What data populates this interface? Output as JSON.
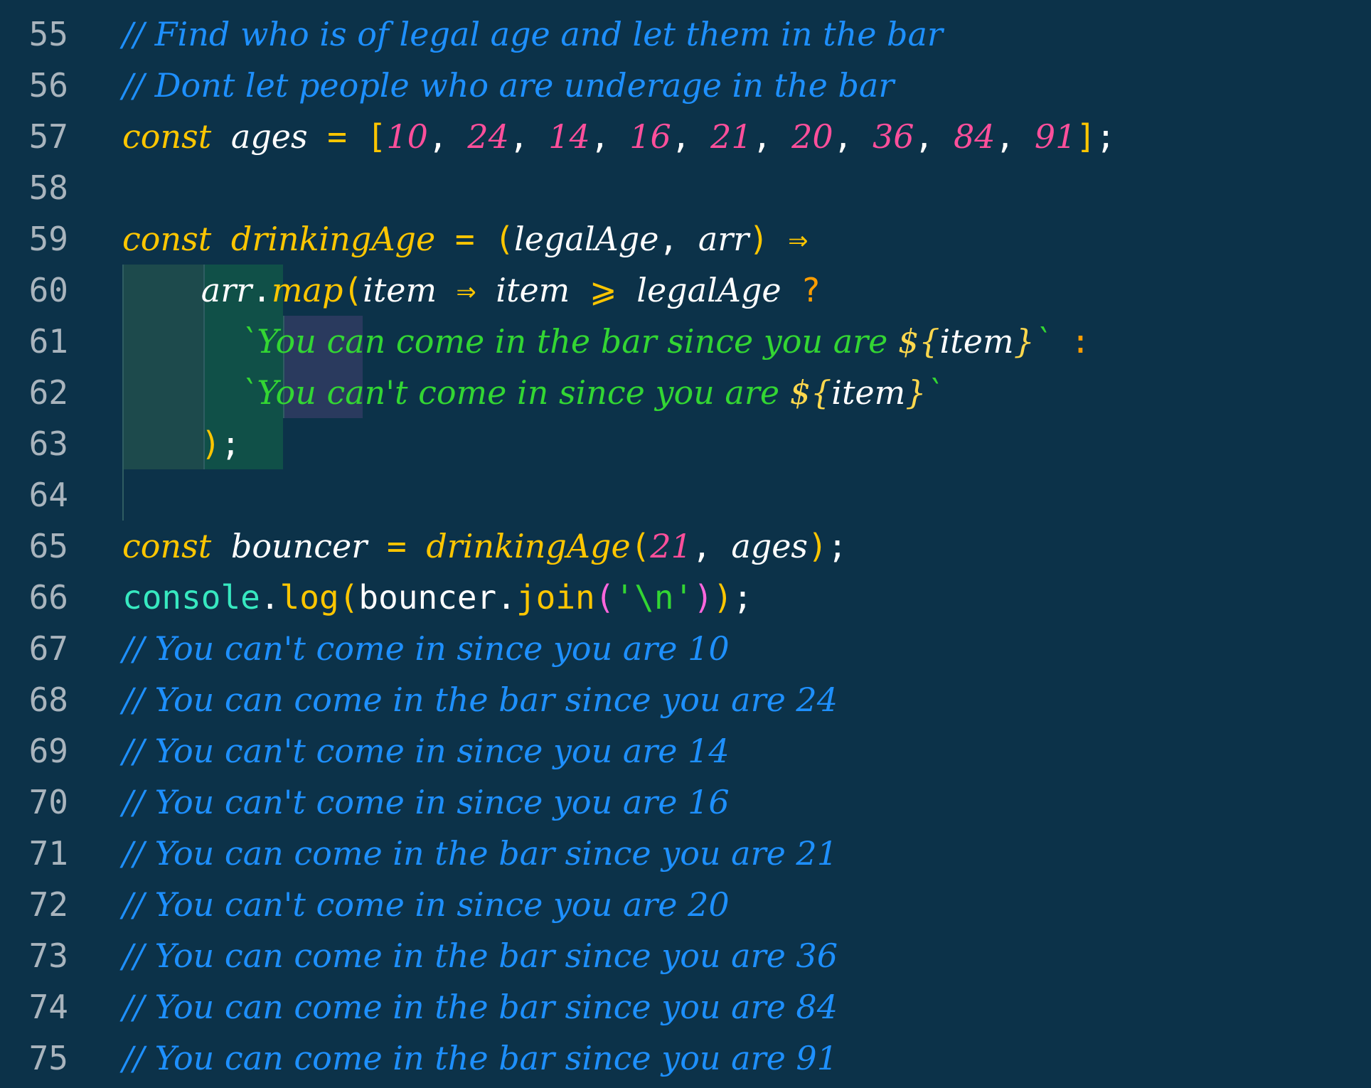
{
  "editor": {
    "colors": {
      "background": "#0c3249",
      "line_number": "#a9b4bd",
      "comment": "#1e90ff",
      "keyword": "#ffc600",
      "number": "#ff4f9b",
      "string": "#33d633",
      "identifier": "#ffffff",
      "operator": "#ffc600",
      "ternary": "#ff9d00",
      "console": "#37e8c0",
      "function": "#ffc600",
      "bracket_pink": "#ff66dd",
      "template_var": "#ffd84d"
    },
    "lines": [
      {
        "number": "55",
        "tokens": [
          {
            "text": "// Find who is of legal age and let them in the bar",
            "kind": "comment",
            "italic": true
          }
        ]
      },
      {
        "number": "56",
        "tokens": [
          {
            "text": "// Dont let people who are underage in the bar",
            "kind": "comment",
            "italic": true
          }
        ]
      },
      {
        "number": "57",
        "tokens": [
          {
            "text": "const",
            "kind": "keyword",
            "italic": true
          },
          {
            "text": " ",
            "kind": "identifier"
          },
          {
            "text": "ages",
            "kind": "identifier",
            "italic": true
          },
          {
            "text": " = ",
            "kind": "operator"
          },
          {
            "text": "[",
            "kind": "keyword"
          },
          {
            "text": "10",
            "kind": "number",
            "italic": true
          },
          {
            "text": ", ",
            "kind": "identifier"
          },
          {
            "text": "24",
            "kind": "number",
            "italic": true
          },
          {
            "text": ", ",
            "kind": "identifier"
          },
          {
            "text": "14",
            "kind": "number",
            "italic": true
          },
          {
            "text": ", ",
            "kind": "identifier"
          },
          {
            "text": "16",
            "kind": "number",
            "italic": true
          },
          {
            "text": ", ",
            "kind": "identifier"
          },
          {
            "text": "21",
            "kind": "number",
            "italic": true
          },
          {
            "text": ", ",
            "kind": "identifier"
          },
          {
            "text": "20",
            "kind": "number",
            "italic": true
          },
          {
            "text": ", ",
            "kind": "identifier"
          },
          {
            "text": "36",
            "kind": "number",
            "italic": true
          },
          {
            "text": ", ",
            "kind": "identifier"
          },
          {
            "text": "84",
            "kind": "number",
            "italic": true
          },
          {
            "text": ", ",
            "kind": "identifier"
          },
          {
            "text": "91",
            "kind": "number",
            "italic": true
          },
          {
            "text": "]",
            "kind": "keyword"
          },
          {
            "text": ";",
            "kind": "identifier"
          }
        ]
      },
      {
        "number": "58",
        "tokens": []
      },
      {
        "number": "59",
        "tokens": [
          {
            "text": "const",
            "kind": "keyword",
            "italic": true
          },
          {
            "text": " ",
            "kind": "identifier"
          },
          {
            "text": "drinkingAge",
            "kind": "function",
            "italic": true
          },
          {
            "text": " = ",
            "kind": "operator"
          },
          {
            "text": "(",
            "kind": "keyword"
          },
          {
            "text": "legalAge",
            "kind": "identifier",
            "italic": true
          },
          {
            "text": ", ",
            "kind": "identifier"
          },
          {
            "text": "arr",
            "kind": "identifier",
            "italic": true
          },
          {
            "text": ")",
            "kind": "keyword"
          },
          {
            "text": " ⇒",
            "kind": "operator"
          }
        ]
      },
      {
        "number": "60",
        "indent": 4,
        "tokens": [
          {
            "text": "arr",
            "kind": "identifier",
            "italic": true
          },
          {
            "text": ".",
            "kind": "identifier"
          },
          {
            "text": "map",
            "kind": "function",
            "italic": true
          },
          {
            "text": "(",
            "kind": "keyword"
          },
          {
            "text": "item",
            "kind": "identifier",
            "italic": true
          },
          {
            "text": " ⇒ ",
            "kind": "operator"
          },
          {
            "text": "item",
            "kind": "identifier",
            "italic": true
          },
          {
            "text": " ⩾ ",
            "kind": "operator"
          },
          {
            "text": "legalAge",
            "kind": "identifier",
            "italic": true
          },
          {
            "text": " ?",
            "kind": "ternary"
          }
        ]
      },
      {
        "number": "61",
        "indent": 6,
        "tokens": [
          {
            "text": "`You can come in the bar since you are ",
            "kind": "string",
            "italic": true
          },
          {
            "text": "${",
            "kind": "template_var",
            "italic": true
          },
          {
            "text": "item",
            "kind": "identifier",
            "italic": true
          },
          {
            "text": "}",
            "kind": "template_var",
            "italic": true
          },
          {
            "text": "`",
            "kind": "string",
            "italic": true
          },
          {
            "text": " :",
            "kind": "ternary"
          }
        ]
      },
      {
        "number": "62",
        "indent": 6,
        "tokens": [
          {
            "text": "`You can't come in since you are ",
            "kind": "string",
            "italic": true
          },
          {
            "text": "${",
            "kind": "template_var",
            "italic": true
          },
          {
            "text": "item",
            "kind": "identifier",
            "italic": true
          },
          {
            "text": "}",
            "kind": "template_var",
            "italic": true
          },
          {
            "text": "`",
            "kind": "string",
            "italic": true
          }
        ]
      },
      {
        "number": "63",
        "indent": 4,
        "tokens": [
          {
            "text": ")",
            "kind": "keyword"
          },
          {
            "text": ";",
            "kind": "identifier"
          }
        ]
      },
      {
        "number": "64",
        "tokens": []
      },
      {
        "number": "65",
        "tokens": [
          {
            "text": "const",
            "kind": "keyword",
            "italic": true
          },
          {
            "text": " ",
            "kind": "identifier"
          },
          {
            "text": "bouncer",
            "kind": "identifier",
            "italic": true
          },
          {
            "text": " = ",
            "kind": "operator"
          },
          {
            "text": "drinkingAge",
            "kind": "function",
            "italic": true
          },
          {
            "text": "(",
            "kind": "keyword"
          },
          {
            "text": "21",
            "kind": "number",
            "italic": true
          },
          {
            "text": ", ",
            "kind": "identifier"
          },
          {
            "text": "ages",
            "kind": "identifier",
            "italic": true
          },
          {
            "text": ")",
            "kind": "keyword"
          },
          {
            "text": ";",
            "kind": "identifier"
          }
        ]
      },
      {
        "number": "66",
        "tokens": [
          {
            "text": "console",
            "kind": "console"
          },
          {
            "text": ".",
            "kind": "identifier"
          },
          {
            "text": "log",
            "kind": "function"
          },
          {
            "text": "(",
            "kind": "keyword"
          },
          {
            "text": "bouncer",
            "kind": "identifier"
          },
          {
            "text": ".",
            "kind": "identifier"
          },
          {
            "text": "join",
            "kind": "function"
          },
          {
            "text": "(",
            "kind": "bracket_pink"
          },
          {
            "text": "'\\n'",
            "kind": "string"
          },
          {
            "text": ")",
            "kind": "bracket_pink"
          },
          {
            "text": ")",
            "kind": "keyword"
          },
          {
            "text": ";",
            "kind": "identifier"
          }
        ]
      },
      {
        "number": "67",
        "tokens": [
          {
            "text": "// You can't come in since you are 10",
            "kind": "comment",
            "italic": true
          }
        ]
      },
      {
        "number": "68",
        "tokens": [
          {
            "text": "// You can come in the bar since you are 24",
            "kind": "comment",
            "italic": true
          }
        ]
      },
      {
        "number": "69",
        "tokens": [
          {
            "text": "// You can't come in since you are 14",
            "kind": "comment",
            "italic": true
          }
        ]
      },
      {
        "number": "70",
        "tokens": [
          {
            "text": "// You can't come in since you are 16",
            "kind": "comment",
            "italic": true
          }
        ]
      },
      {
        "number": "71",
        "tokens": [
          {
            "text": "// You can come in the bar since you are 21",
            "kind": "comment",
            "italic": true
          }
        ]
      },
      {
        "number": "72",
        "tokens": [
          {
            "text": "// You can't come in since you are 20",
            "kind": "comment",
            "italic": true
          }
        ]
      },
      {
        "number": "73",
        "tokens": [
          {
            "text": "// You can come in the bar since you are 36",
            "kind": "comment",
            "italic": true
          }
        ]
      },
      {
        "number": "74",
        "tokens": [
          {
            "text": "// You can come in the bar since you are 84",
            "kind": "comment",
            "italic": true
          }
        ]
      },
      {
        "number": "75",
        "tokens": [
          {
            "text": "// You can come in the bar since you are 91",
            "kind": "comment",
            "italic": true
          }
        ]
      }
    ]
  }
}
